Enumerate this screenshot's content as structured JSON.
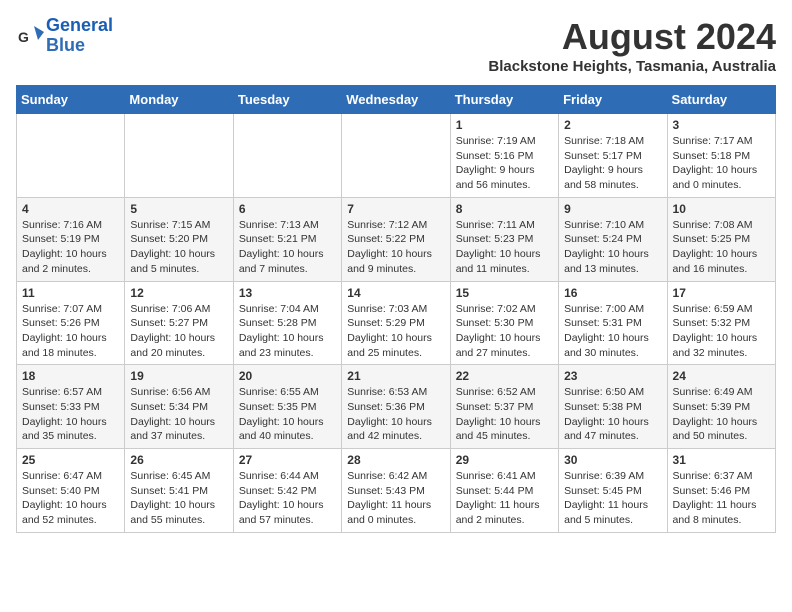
{
  "header": {
    "logo_line1": "General",
    "logo_line2": "Blue",
    "month_year": "August 2024",
    "location": "Blackstone Heights, Tasmania, Australia"
  },
  "weekdays": [
    "Sunday",
    "Monday",
    "Tuesday",
    "Wednesday",
    "Thursday",
    "Friday",
    "Saturday"
  ],
  "weeks": [
    [
      {
        "day": "",
        "info": ""
      },
      {
        "day": "",
        "info": ""
      },
      {
        "day": "",
        "info": ""
      },
      {
        "day": "",
        "info": ""
      },
      {
        "day": "1",
        "info": "Sunrise: 7:19 AM\nSunset: 5:16 PM\nDaylight: 9 hours and 56 minutes."
      },
      {
        "day": "2",
        "info": "Sunrise: 7:18 AM\nSunset: 5:17 PM\nDaylight: 9 hours and 58 minutes."
      },
      {
        "day": "3",
        "info": "Sunrise: 7:17 AM\nSunset: 5:18 PM\nDaylight: 10 hours and 0 minutes."
      }
    ],
    [
      {
        "day": "4",
        "info": "Sunrise: 7:16 AM\nSunset: 5:19 PM\nDaylight: 10 hours and 2 minutes."
      },
      {
        "day": "5",
        "info": "Sunrise: 7:15 AM\nSunset: 5:20 PM\nDaylight: 10 hours and 5 minutes."
      },
      {
        "day": "6",
        "info": "Sunrise: 7:13 AM\nSunset: 5:21 PM\nDaylight: 10 hours and 7 minutes."
      },
      {
        "day": "7",
        "info": "Sunrise: 7:12 AM\nSunset: 5:22 PM\nDaylight: 10 hours and 9 minutes."
      },
      {
        "day": "8",
        "info": "Sunrise: 7:11 AM\nSunset: 5:23 PM\nDaylight: 10 hours and 11 minutes."
      },
      {
        "day": "9",
        "info": "Sunrise: 7:10 AM\nSunset: 5:24 PM\nDaylight: 10 hours and 13 minutes."
      },
      {
        "day": "10",
        "info": "Sunrise: 7:08 AM\nSunset: 5:25 PM\nDaylight: 10 hours and 16 minutes."
      }
    ],
    [
      {
        "day": "11",
        "info": "Sunrise: 7:07 AM\nSunset: 5:26 PM\nDaylight: 10 hours and 18 minutes."
      },
      {
        "day": "12",
        "info": "Sunrise: 7:06 AM\nSunset: 5:27 PM\nDaylight: 10 hours and 20 minutes."
      },
      {
        "day": "13",
        "info": "Sunrise: 7:04 AM\nSunset: 5:28 PM\nDaylight: 10 hours and 23 minutes."
      },
      {
        "day": "14",
        "info": "Sunrise: 7:03 AM\nSunset: 5:29 PM\nDaylight: 10 hours and 25 minutes."
      },
      {
        "day": "15",
        "info": "Sunrise: 7:02 AM\nSunset: 5:30 PM\nDaylight: 10 hours and 27 minutes."
      },
      {
        "day": "16",
        "info": "Sunrise: 7:00 AM\nSunset: 5:31 PM\nDaylight: 10 hours and 30 minutes."
      },
      {
        "day": "17",
        "info": "Sunrise: 6:59 AM\nSunset: 5:32 PM\nDaylight: 10 hours and 32 minutes."
      }
    ],
    [
      {
        "day": "18",
        "info": "Sunrise: 6:57 AM\nSunset: 5:33 PM\nDaylight: 10 hours and 35 minutes."
      },
      {
        "day": "19",
        "info": "Sunrise: 6:56 AM\nSunset: 5:34 PM\nDaylight: 10 hours and 37 minutes."
      },
      {
        "day": "20",
        "info": "Sunrise: 6:55 AM\nSunset: 5:35 PM\nDaylight: 10 hours and 40 minutes."
      },
      {
        "day": "21",
        "info": "Sunrise: 6:53 AM\nSunset: 5:36 PM\nDaylight: 10 hours and 42 minutes."
      },
      {
        "day": "22",
        "info": "Sunrise: 6:52 AM\nSunset: 5:37 PM\nDaylight: 10 hours and 45 minutes."
      },
      {
        "day": "23",
        "info": "Sunrise: 6:50 AM\nSunset: 5:38 PM\nDaylight: 10 hours and 47 minutes."
      },
      {
        "day": "24",
        "info": "Sunrise: 6:49 AM\nSunset: 5:39 PM\nDaylight: 10 hours and 50 minutes."
      }
    ],
    [
      {
        "day": "25",
        "info": "Sunrise: 6:47 AM\nSunset: 5:40 PM\nDaylight: 10 hours and 52 minutes."
      },
      {
        "day": "26",
        "info": "Sunrise: 6:45 AM\nSunset: 5:41 PM\nDaylight: 10 hours and 55 minutes."
      },
      {
        "day": "27",
        "info": "Sunrise: 6:44 AM\nSunset: 5:42 PM\nDaylight: 10 hours and 57 minutes."
      },
      {
        "day": "28",
        "info": "Sunrise: 6:42 AM\nSunset: 5:43 PM\nDaylight: 11 hours and 0 minutes."
      },
      {
        "day": "29",
        "info": "Sunrise: 6:41 AM\nSunset: 5:44 PM\nDaylight: 11 hours and 2 minutes."
      },
      {
        "day": "30",
        "info": "Sunrise: 6:39 AM\nSunset: 5:45 PM\nDaylight: 11 hours and 5 minutes."
      },
      {
        "day": "31",
        "info": "Sunrise: 6:37 AM\nSunset: 5:46 PM\nDaylight: 11 hours and 8 minutes."
      }
    ]
  ]
}
